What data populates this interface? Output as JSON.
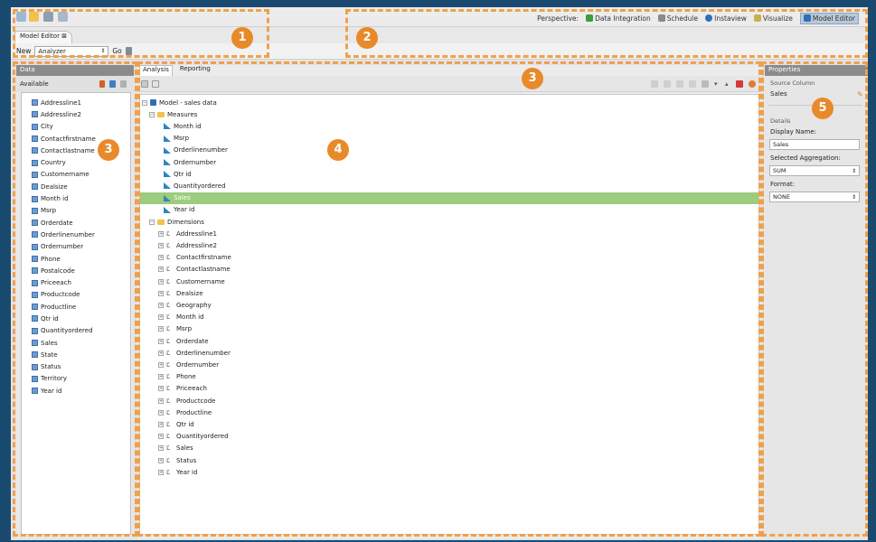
{
  "colors": {
    "frame": "#1a4a70",
    "accent": "#e88a2a",
    "dash": "#f0a04c",
    "selected_row": "#9ccc7d",
    "panel_header": "#8b8b8b"
  },
  "toolbar": {
    "icons": [
      "new-icon",
      "open-icon",
      "save-icon",
      "save-as-icon"
    ]
  },
  "perspective": {
    "label": "Perspective:",
    "items": [
      {
        "label": "Data Integration",
        "icon": "data-integration-icon",
        "color": "#3f9b3f",
        "active": false
      },
      {
        "label": "Schedule",
        "icon": "schedule-icon",
        "color": "#8a8a8a",
        "active": false
      },
      {
        "label": "Instaview",
        "icon": "instaview-icon",
        "color": "#2f6fb7",
        "active": false
      },
      {
        "label": "Visualize",
        "icon": "visualize-icon",
        "color": "#c6b14f",
        "active": false
      },
      {
        "label": "Model Editor",
        "icon": "model-editor-icon",
        "color": "#2f6fb7",
        "active": true
      }
    ]
  },
  "editor_tab": {
    "label": "Model Editor ⊠"
  },
  "newbar": {
    "label": "New",
    "select_value": "Analyzer",
    "go_label": "Go"
  },
  "data_panel": {
    "title": "Data",
    "available_label": "Available",
    "items": [
      "Addressline1",
      "Addressline2",
      "City",
      "Contactfirstname",
      "Contactlastname",
      "Country",
      "Customername",
      "Dealsize",
      "Month id",
      "Msrp",
      "Orderdate",
      "Orderlinenumber",
      "Ordernumber",
      "Phone",
      "Postalcode",
      "Priceeach",
      "Productcode",
      "Productline",
      "Qtr id",
      "Quantityordered",
      "Sales",
      "State",
      "Status",
      "Territory",
      "Year id"
    ]
  },
  "analysis": {
    "tabs": [
      "Analysis",
      "Reporting"
    ],
    "tree": {
      "root": "Model - sales data",
      "measures_label": "Measures",
      "measures": [
        "Month id",
        "Msrp",
        "Orderlinenumber",
        "Ordernumber",
        "Qtr id",
        "Quantityordered",
        "Sales",
        "Year id"
      ],
      "selected_measure": "Sales",
      "dimensions_label": "Dimensions",
      "dimensions": [
        "Addressline1",
        "Addressline2",
        "Contactfirstname",
        "Contactlastname",
        "Customername",
        "Dealsize",
        "Geography",
        "Month id",
        "Msrp",
        "Orderdate",
        "Orderlinenumber",
        "Ordernumber",
        "Phone",
        "Priceeach",
        "Productcode",
        "Productline",
        "Qtr id",
        "Quantityordered",
        "Sales",
        "Status",
        "Year id"
      ]
    }
  },
  "properties": {
    "title": "Properties",
    "source_column_label": "Source Column",
    "source_column_value": "Sales",
    "details_label": "Details",
    "display_name_label": "Display Name:",
    "display_name_value": "Sales",
    "aggregation_label": "Selected Aggregation:",
    "aggregation_value": "SUM",
    "format_label": "Format:",
    "format_value": "NONE"
  },
  "callouts": [
    "1",
    "2",
    "3",
    "3",
    "4",
    "5"
  ]
}
